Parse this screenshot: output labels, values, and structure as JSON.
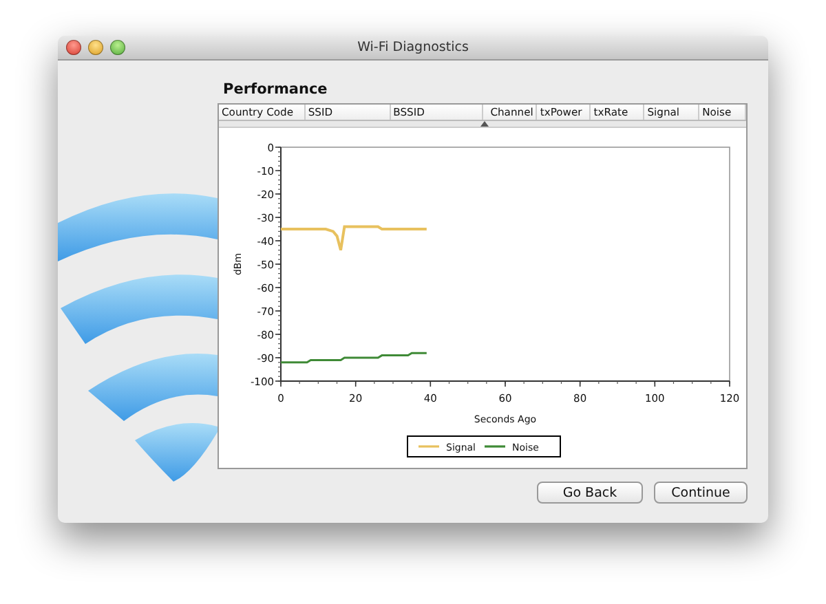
{
  "window": {
    "title": "Wi-Fi Diagnostics"
  },
  "section_title": "Performance",
  "table": {
    "columns": [
      "Country Code",
      "SSID",
      "BSSID",
      "Channel",
      "txPower",
      "txRate",
      "Signal",
      "Noise"
    ]
  },
  "chart": {
    "chart_data": {
      "type": "line",
      "xlabel": "Seconds Ago",
      "ylabel": "dBm",
      "x": [
        0,
        4,
        7,
        8,
        12,
        14,
        15,
        16,
        17,
        20,
        24,
        26,
        27,
        30,
        34,
        35,
        39
      ],
      "series": [
        {
          "name": "Signal",
          "color": "#e8c15e",
          "values": [
            -35,
            -35,
            -35,
            -35,
            -35,
            -36,
            -38,
            -44,
            -34,
            -34,
            -34,
            -34,
            -35,
            -35,
            -35,
            -35,
            -35
          ]
        },
        {
          "name": "Noise",
          "color": "#3f8a36",
          "values": [
            -92,
            -92,
            -92,
            -91,
            -91,
            -91,
            -91,
            -91,
            -90,
            -90,
            -90,
            -90,
            -89,
            -89,
            -89,
            -88,
            -88
          ]
        }
      ],
      "xlim": [
        0,
        120
      ],
      "ylim": [
        -100,
        0
      ],
      "xticks": [
        0,
        20,
        40,
        60,
        80,
        100,
        120
      ],
      "yticks": [
        0,
        -10,
        -20,
        -30,
        -40,
        -50,
        -60,
        -70,
        -80,
        -90,
        -100
      ],
      "legend": true
    }
  },
  "buttons": [
    "Go Back",
    "Continue"
  ]
}
